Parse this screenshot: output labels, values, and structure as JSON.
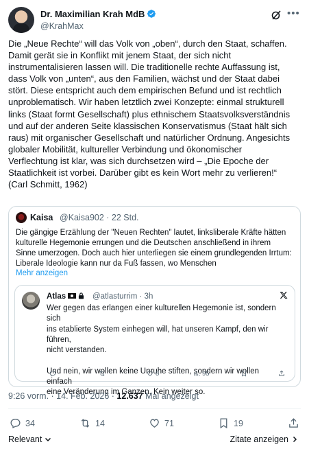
{
  "author": {
    "name": "Dr. Maximilian Krah MdB",
    "handle": "@KrahMax"
  },
  "tweet_text": "Die „Neue Rechte“ will das Volk von „oben“, durch den Staat, schaffen.\nDamit gerät sie in Konflikt mit jenem Staat, der sich nicht\ninstrumentalisieren lassen will. Die traditionelle rechte Auffassung ist,\ndass Volk von „unten“, aus den Familien, wächst und der Staat dabei\nstört. Diese entspricht auch dem empirischen Befund und ist rechtlich\nunproblematisch. Wir haben letztlich zwei Konzepte: einmal strukturell\nlinks (Staat formt Gesellschaft) plus ethnischem Staatsvolksverständnis\nund auf der anderen Seite klassischen Konservatismus (Staat hält sich\nraus) mit organischer Gesellschaft und natürlicher Ordnung. Angesichts\nglobaler Mobilität, kultureller Verbindung und ökonomischer\nVerflechtung ist klar, was sich durchsetzen wird – „Die Epoche der\nStaatlichkeit ist vorbei. Darüber gibt es kein Wort mehr zu verlieren!“\n(Carl Schmitt, 1962)",
  "quote": {
    "name": "Kaisa",
    "meta": "@Kaisa902 · 22 Std.",
    "text": "Die gängige Erzählung der \"Neuen Rechten\" lautet, linksliberale Kräfte hätten\nkulturelle Hegemonie errungen und die Deutschen anschließend in ihrem\nSinne umerzogen. Doch auch hier unterliegen sie einem grundlegenden Irrtum:\nLiberale Ideologie kann nur da Fuß fassen, wo Menschen",
    "more": "Mehr anzeigen"
  },
  "nested_quote": {
    "name": "Atlas",
    "meta": "@atlasturrim · 3h",
    "text": "Wer gegen das erlangen einer kulturellen Hegemonie ist, sondern sich\nins etablierte System einhegen will, hat unseren Kampf, den wir führen,\nnicht verstanden.\n\nUnd nein, wir wollen keine Unruhe stiften, sondern wir wollen einfach\neine Veränderung im Ganzen. Kein weiter so.",
    "likes": "8",
    "views": "95"
  },
  "timestamp": {
    "time": "9:26 vorm. · 14. Feb. 2026 · ",
    "views": "12.637",
    "views_label": " Mal angezeigt"
  },
  "actions": {
    "replies": "34",
    "reposts": "14",
    "likes": "71",
    "bookmarks": "19"
  },
  "footer": {
    "relevant": "Relevant",
    "quotes": "Zitate anzeigen"
  },
  "colors": {
    "text": "#0f1419",
    "secondary": "#536471",
    "link": "#1d9bf0",
    "verified": "#1d9bf0",
    "border": "#cfd9de"
  },
  "icons": [
    "verified-badge-icon",
    "grok-icon",
    "more-icon",
    "flag-icon",
    "lock-icon",
    "x-logo-icon",
    "reply-icon",
    "repost-icon",
    "like-icon",
    "views-icon",
    "bookmark-icon",
    "share-icon",
    "chevron-down-icon",
    "chevron-right-icon"
  ]
}
